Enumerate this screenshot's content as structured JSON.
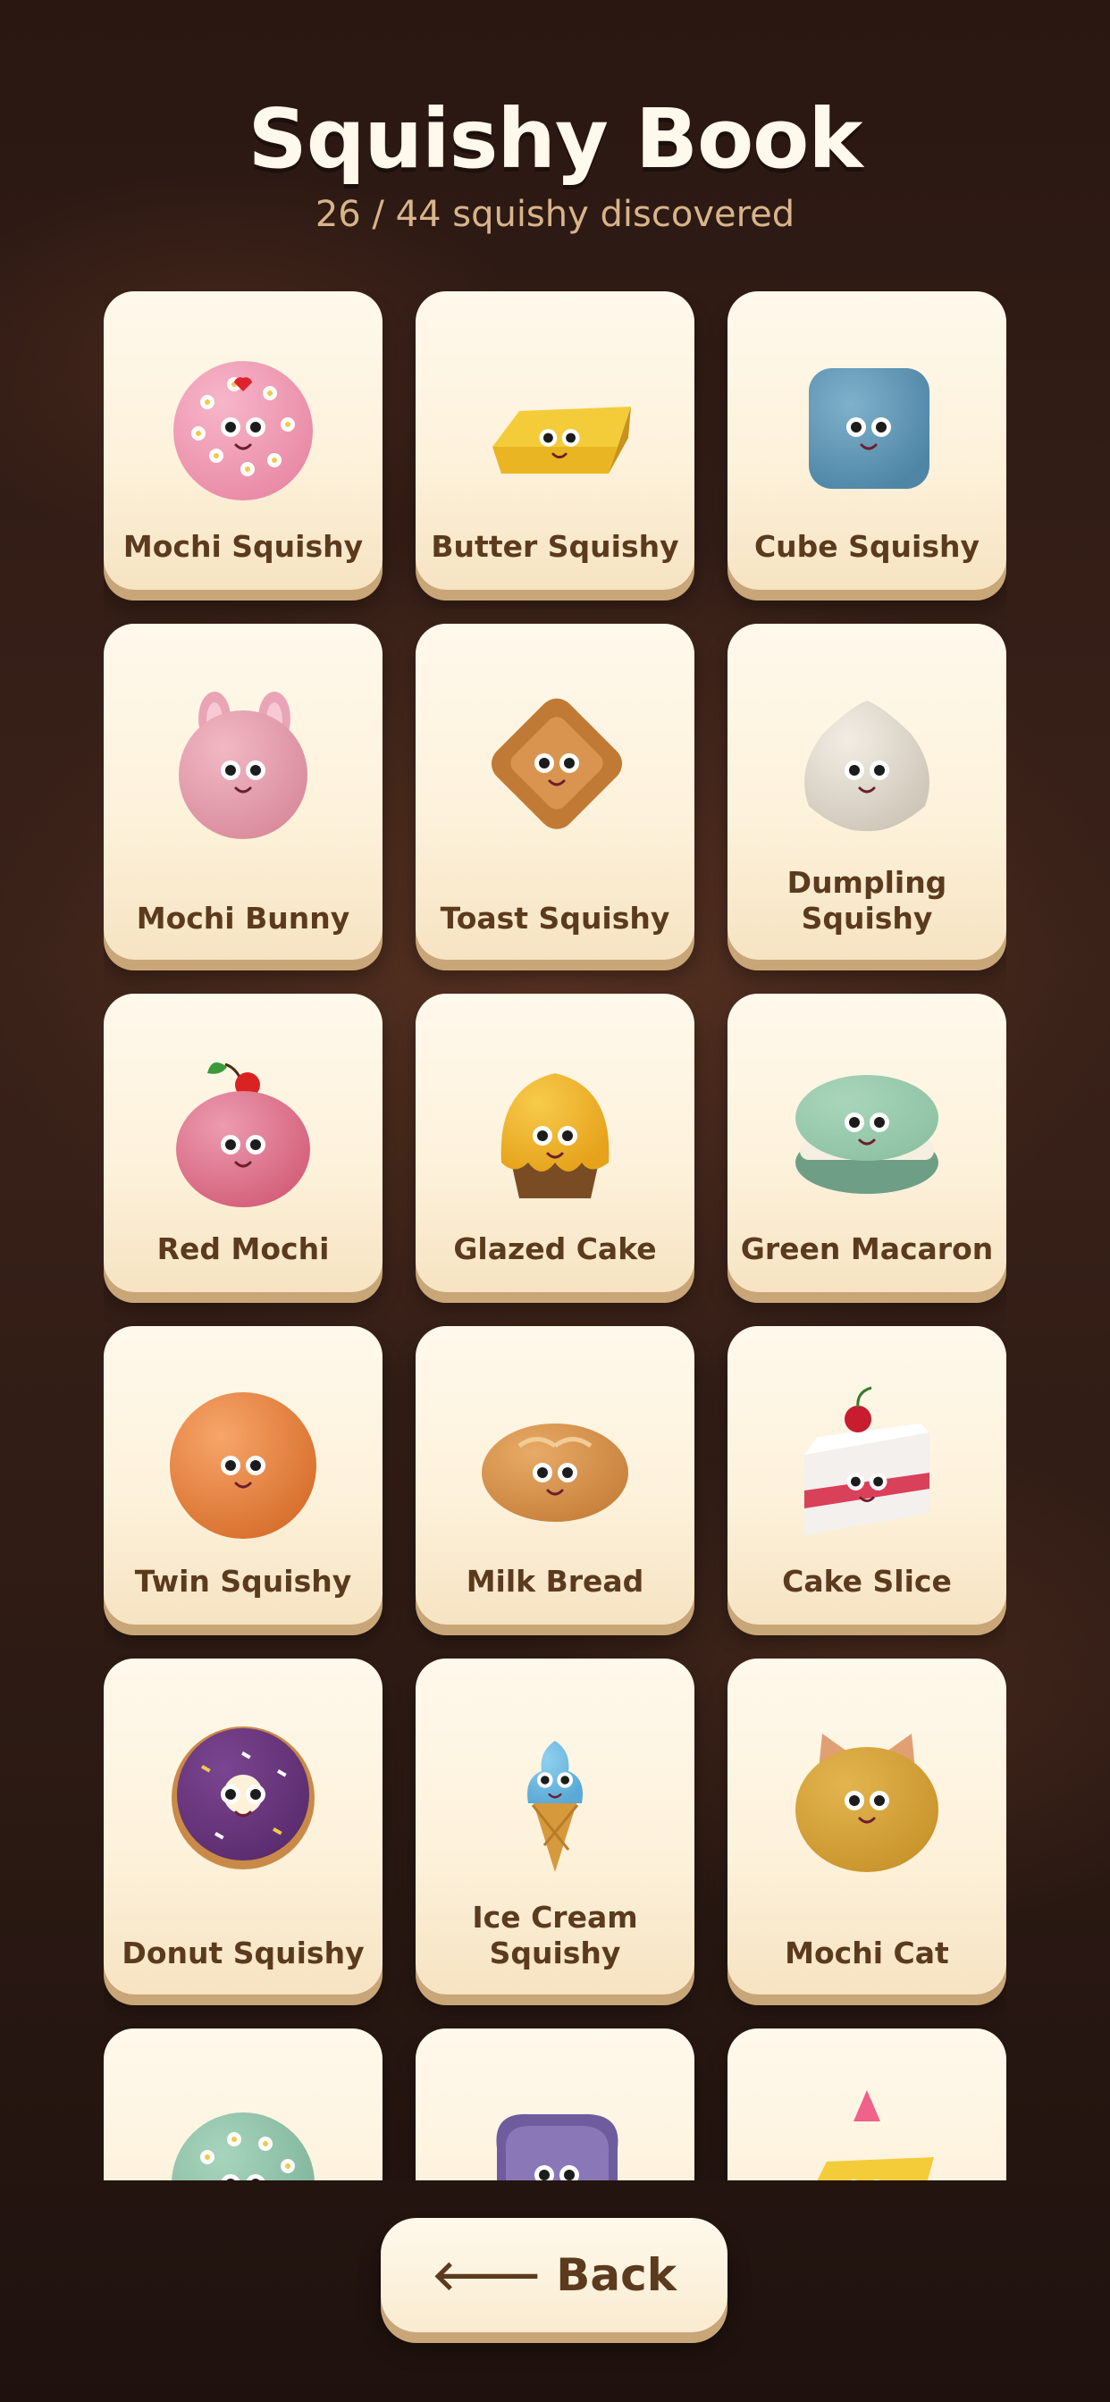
{
  "header": {
    "title": "Squishy Book",
    "subtitle": "26 / 44 squishy discovered"
  },
  "cards": [
    {
      "label": "Mochi Squishy",
      "icon": "pink-flower-mochi-icon",
      "color": "#e98aa6"
    },
    {
      "label": "Butter Squishy",
      "icon": "butter-stick-icon",
      "color": "#e9b522"
    },
    {
      "label": "Cube Squishy",
      "icon": "blue-cube-icon",
      "color": "#4f86a6"
    },
    {
      "label": "Mochi Bunny",
      "icon": "bunny-mochi-icon",
      "color": "#d98c9c"
    },
    {
      "label": "Toast Squishy",
      "icon": "toast-icon",
      "color": "#c07a35"
    },
    {
      "label": "Dumpling Squishy",
      "icon": "dumpling-icon",
      "color": "#cfc7b9"
    },
    {
      "label": "Red Mochi",
      "icon": "cherry-mochi-icon",
      "color": "#d4607a"
    },
    {
      "label": "Glazed Cake",
      "icon": "glazed-cake-icon",
      "color": "#e6a21b"
    },
    {
      "label": "Green Macaron",
      "icon": "macaron-icon",
      "color": "#8fc2a4"
    },
    {
      "label": "Twin Squishy",
      "icon": "orange-ball-icon",
      "color": "#d8702d"
    },
    {
      "label": "Milk Bread",
      "icon": "bread-bun-icon",
      "color": "#c8813c"
    },
    {
      "label": "Cake Slice",
      "icon": "cake-slice-icon",
      "color": "#d9405a"
    },
    {
      "label": "Donut Squishy",
      "icon": "donut-icon",
      "color": "#5b2c6f"
    },
    {
      "label": "Ice Cream Squishy",
      "icon": "ice-cream-cone-icon",
      "color": "#5aa9d6"
    },
    {
      "label": "Mochi Cat",
      "icon": "cat-mochi-icon",
      "color": "#c9942c"
    },
    {
      "label": "",
      "icon": "green-flower-mochi-icon",
      "color": "#7fb59a"
    },
    {
      "label": "",
      "icon": "purple-toast-icon",
      "color": "#8a77b8"
    },
    {
      "label": "",
      "icon": "party-butter-icon",
      "color": "#e0a81c"
    }
  ],
  "back": {
    "label": "Back",
    "icon": "arrow-left-icon"
  }
}
